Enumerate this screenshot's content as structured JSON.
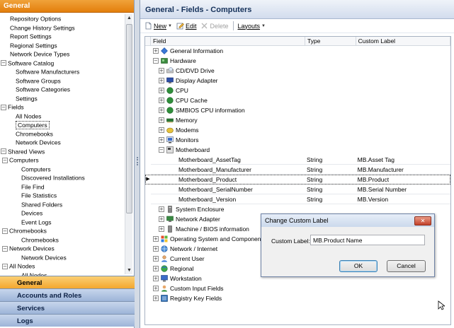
{
  "left_panel": {
    "header": "General",
    "tree": [
      {
        "label": "Repository Options",
        "level": 1,
        "exp": ""
      },
      {
        "label": "Change History Settings",
        "level": 1,
        "exp": ""
      },
      {
        "label": "Report Settings",
        "level": 1,
        "exp": ""
      },
      {
        "label": "Regional Settings",
        "level": 1,
        "exp": ""
      },
      {
        "label": "Network Device Types",
        "level": 1,
        "exp": ""
      },
      {
        "label": "Software Catalog",
        "level": 0,
        "exp": "−"
      },
      {
        "label": "Software Manufacturers",
        "level": 2,
        "exp": ""
      },
      {
        "label": "Software Groups",
        "level": 2,
        "exp": ""
      },
      {
        "label": "Software Categories",
        "level": 2,
        "exp": ""
      },
      {
        "label": "Settings",
        "level": 2,
        "exp": ""
      },
      {
        "label": "Fields",
        "level": 0,
        "exp": "−"
      },
      {
        "label": "All Nodes",
        "level": 2,
        "exp": ""
      },
      {
        "label": "Computers",
        "level": 2,
        "exp": "",
        "selected": true
      },
      {
        "label": "Chromebooks",
        "level": 2,
        "exp": ""
      },
      {
        "label": "Network Devices",
        "level": 2,
        "exp": ""
      },
      {
        "label": "Shared Views",
        "level": 0,
        "exp": "−"
      },
      {
        "label": "Computers",
        "level": 1,
        "exp": "−"
      },
      {
        "label": "Computers",
        "level": 3,
        "exp": ""
      },
      {
        "label": "Discovered Installations",
        "level": 3,
        "exp": ""
      },
      {
        "label": "File Find",
        "level": 3,
        "exp": ""
      },
      {
        "label": "File Statistics",
        "level": 3,
        "exp": ""
      },
      {
        "label": "Shared Folders",
        "level": 3,
        "exp": ""
      },
      {
        "label": "Devices",
        "level": 3,
        "exp": ""
      },
      {
        "label": "Event Logs",
        "level": 3,
        "exp": ""
      },
      {
        "label": "Chromebooks",
        "level": 1,
        "exp": "−"
      },
      {
        "label": "Chromebooks",
        "level": 3,
        "exp": ""
      },
      {
        "label": "Network Devices",
        "level": 1,
        "exp": "−"
      },
      {
        "label": "Network Devices",
        "level": 3,
        "exp": ""
      },
      {
        "label": "All  Nodes",
        "level": 1,
        "exp": "−"
      },
      {
        "label": "All Nodes",
        "level": 3,
        "exp": ""
      }
    ],
    "nav_buttons": [
      {
        "label": "General",
        "active": true
      },
      {
        "label": "Accounts and Roles",
        "active": false
      },
      {
        "label": "Services",
        "active": false
      },
      {
        "label": "Logs",
        "active": false
      }
    ]
  },
  "right_panel": {
    "title": "General - Fields - Computers",
    "toolbar": {
      "new_label": "New",
      "edit_label": "Edit",
      "delete_label": "Delete",
      "layouts_label": "Layouts"
    },
    "columns": {
      "field": "Field",
      "type": "Type",
      "custom_label": "Custom Label"
    },
    "rows": [
      {
        "label": "General Information",
        "level": 0,
        "exp": "+",
        "icon": "info-icon",
        "type": "",
        "custom": ""
      },
      {
        "label": "Hardware",
        "level": 0,
        "exp": "−",
        "icon": "hardware-icon",
        "type": "",
        "custom": ""
      },
      {
        "label": "CD/DVD Drive",
        "level": 1,
        "exp": "+",
        "icon": "cd-drive-icon",
        "type": "",
        "custom": ""
      },
      {
        "label": "Display Adapter",
        "level": 1,
        "exp": "+",
        "icon": "display-adapter-icon",
        "type": "",
        "custom": ""
      },
      {
        "label": "CPU",
        "level": 1,
        "exp": "+",
        "icon": "cpu-icon",
        "type": "",
        "custom": ""
      },
      {
        "label": "CPU Cache",
        "level": 1,
        "exp": "+",
        "icon": "cpu-cache-icon",
        "type": "",
        "custom": ""
      },
      {
        "label": "SMBIOS CPU information",
        "level": 1,
        "exp": "+",
        "icon": "smbios-icon",
        "type": "",
        "custom": ""
      },
      {
        "label": "Memory",
        "level": 1,
        "exp": "+",
        "icon": "memory-icon",
        "type": "",
        "custom": ""
      },
      {
        "label": "Modems",
        "level": 1,
        "exp": "+",
        "icon": "modem-icon",
        "type": "",
        "custom": ""
      },
      {
        "label": "Monitors",
        "level": 1,
        "exp": "+",
        "icon": "monitor-icon",
        "type": "",
        "custom": ""
      },
      {
        "label": "Motherboard",
        "level": 1,
        "exp": "−",
        "icon": "motherboard-icon",
        "type": "",
        "custom": ""
      },
      {
        "label": "Motherboard_AssetTag",
        "level": 3,
        "exp": "",
        "icon": "",
        "type": "String",
        "custom": "MB.Asset Tag",
        "leaf": true
      },
      {
        "label": "Motherboard_Manufacturer",
        "level": 3,
        "exp": "",
        "icon": "",
        "type": "String",
        "custom": "MB.Manufacturer",
        "leaf": true
      },
      {
        "label": "Motherboard_Product",
        "level": 3,
        "exp": "",
        "icon": "",
        "type": "String",
        "custom": "MB.Product",
        "leaf": true,
        "current": true
      },
      {
        "label": "Motherboard_SerialNumber",
        "level": 3,
        "exp": "",
        "icon": "",
        "type": "String",
        "custom": "MB.Serial Number",
        "leaf": true
      },
      {
        "label": "Motherboard_Version",
        "level": 3,
        "exp": "",
        "icon": "",
        "type": "String",
        "custom": "MB.Version",
        "leaf": true
      },
      {
        "label": "System Enclosure",
        "level": 1,
        "exp": "+",
        "icon": "enclosure-icon",
        "type": "",
        "custom": ""
      },
      {
        "label": "Network Adapter",
        "level": 1,
        "exp": "+",
        "icon": "network-adapter-icon",
        "type": "",
        "custom": ""
      },
      {
        "label": "Machine / BIOS information",
        "level": 1,
        "exp": "+",
        "icon": "bios-icon",
        "type": "",
        "custom": ""
      },
      {
        "label": "Operating System and Components",
        "level": 0,
        "exp": "+",
        "icon": "os-icon",
        "type": "",
        "custom": ""
      },
      {
        "label": "Network / Internet",
        "level": 0,
        "exp": "+",
        "icon": "network-icon",
        "type": "",
        "custom": ""
      },
      {
        "label": "Current User",
        "level": 0,
        "exp": "+",
        "icon": "user-icon",
        "type": "",
        "custom": ""
      },
      {
        "label": "Regional",
        "level": 0,
        "exp": "+",
        "icon": "globe-icon",
        "type": "",
        "custom": ""
      },
      {
        "label": "Workstation",
        "level": 0,
        "exp": "+",
        "icon": "workstation-icon",
        "type": "",
        "custom": ""
      },
      {
        "label": "Custom Input Fields",
        "level": 0,
        "exp": "+",
        "icon": "custom-input-icon",
        "type": "",
        "custom": ""
      },
      {
        "label": "Registry Key Fields",
        "level": 0,
        "exp": "+",
        "icon": "registry-icon",
        "type": "",
        "custom": ""
      }
    ]
  },
  "dialog": {
    "title": "Change Custom Label",
    "close_glyph": "✕",
    "field_label": "Custom Label:",
    "field_value": "MB.Product Name",
    "ok_label": "OK",
    "cancel_label": "Cancel"
  },
  "colors": {
    "accent_orange": "#f0a23a",
    "nav_blue": "#9db4d8",
    "title_blue": "#15315a"
  }
}
